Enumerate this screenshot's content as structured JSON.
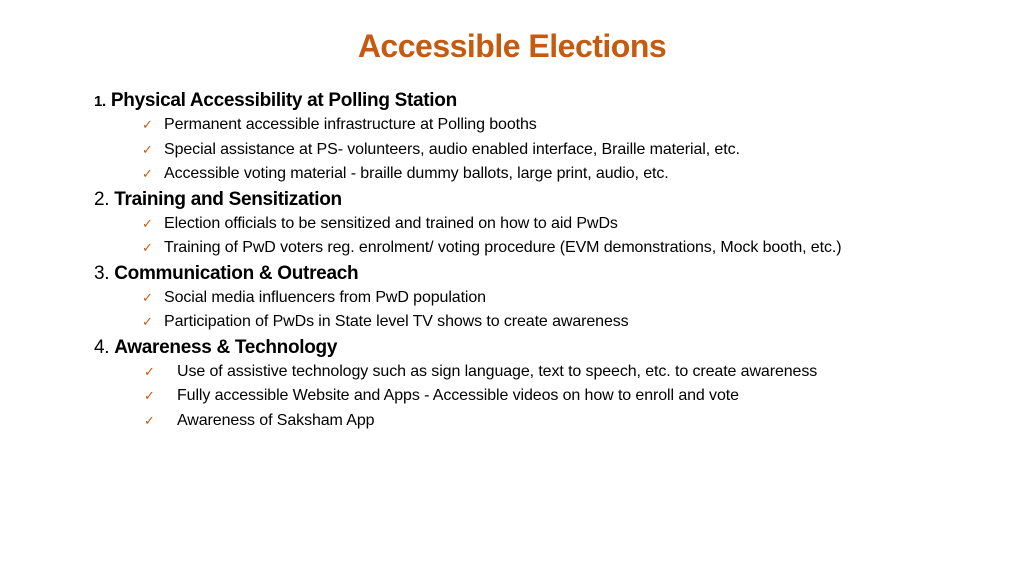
{
  "title": "Accessible Elections",
  "accent_color": "#c55a11",
  "sections": [
    {
      "number": "1.",
      "heading": "Physical Accessibility at Polling Station",
      "items": [
        {
          "icon": "checkmark-icon",
          "text": "Permanent accessible infrastructure at Polling booths"
        },
        {
          "icon": "checkmark-icon",
          "text": "Special assistance at PS- volunteers, audio enabled interface, Braille material, etc."
        },
        {
          "icon": "checkmark-icon",
          "text": "Accessible voting material - braille dummy ballots, large print, audio, etc."
        }
      ]
    },
    {
      "number": "2.",
      "heading": "Training and Sensitization",
      "items": [
        {
          "icon": "checkmark-icon",
          "text": "Election officials to be sensitized and trained on how to aid PwDs"
        },
        {
          "icon": "checkmark-icon",
          "text": "Training of PwD voters reg. enrolment/ voting procedure (EVM demonstrations, Mock booth, etc.)"
        }
      ]
    },
    {
      "number": "3.",
      "heading": "Communication & Outreach",
      "items": [
        {
          "icon": "checkmark-icon",
          "text": "Social media influencers from PwD population"
        },
        {
          "icon": "checkmark-icon",
          "text": "Participation of PwDs in State level TV shows to create awareness"
        }
      ]
    },
    {
      "number": "4.",
      "heading": "Awareness & Technology",
      "items": [
        {
          "icon": "checkmark-icon",
          "text": "Use of assistive technology such as sign language, text to speech, etc. to create awareness"
        },
        {
          "icon": "checkmark-icon",
          "text": "Fully accessible Website and Apps - Accessible videos on how to enroll and vote"
        },
        {
          "icon": "checkmark-icon",
          "text": "Awareness of Saksham App"
        }
      ]
    }
  ],
  "check_glyph": "✓"
}
